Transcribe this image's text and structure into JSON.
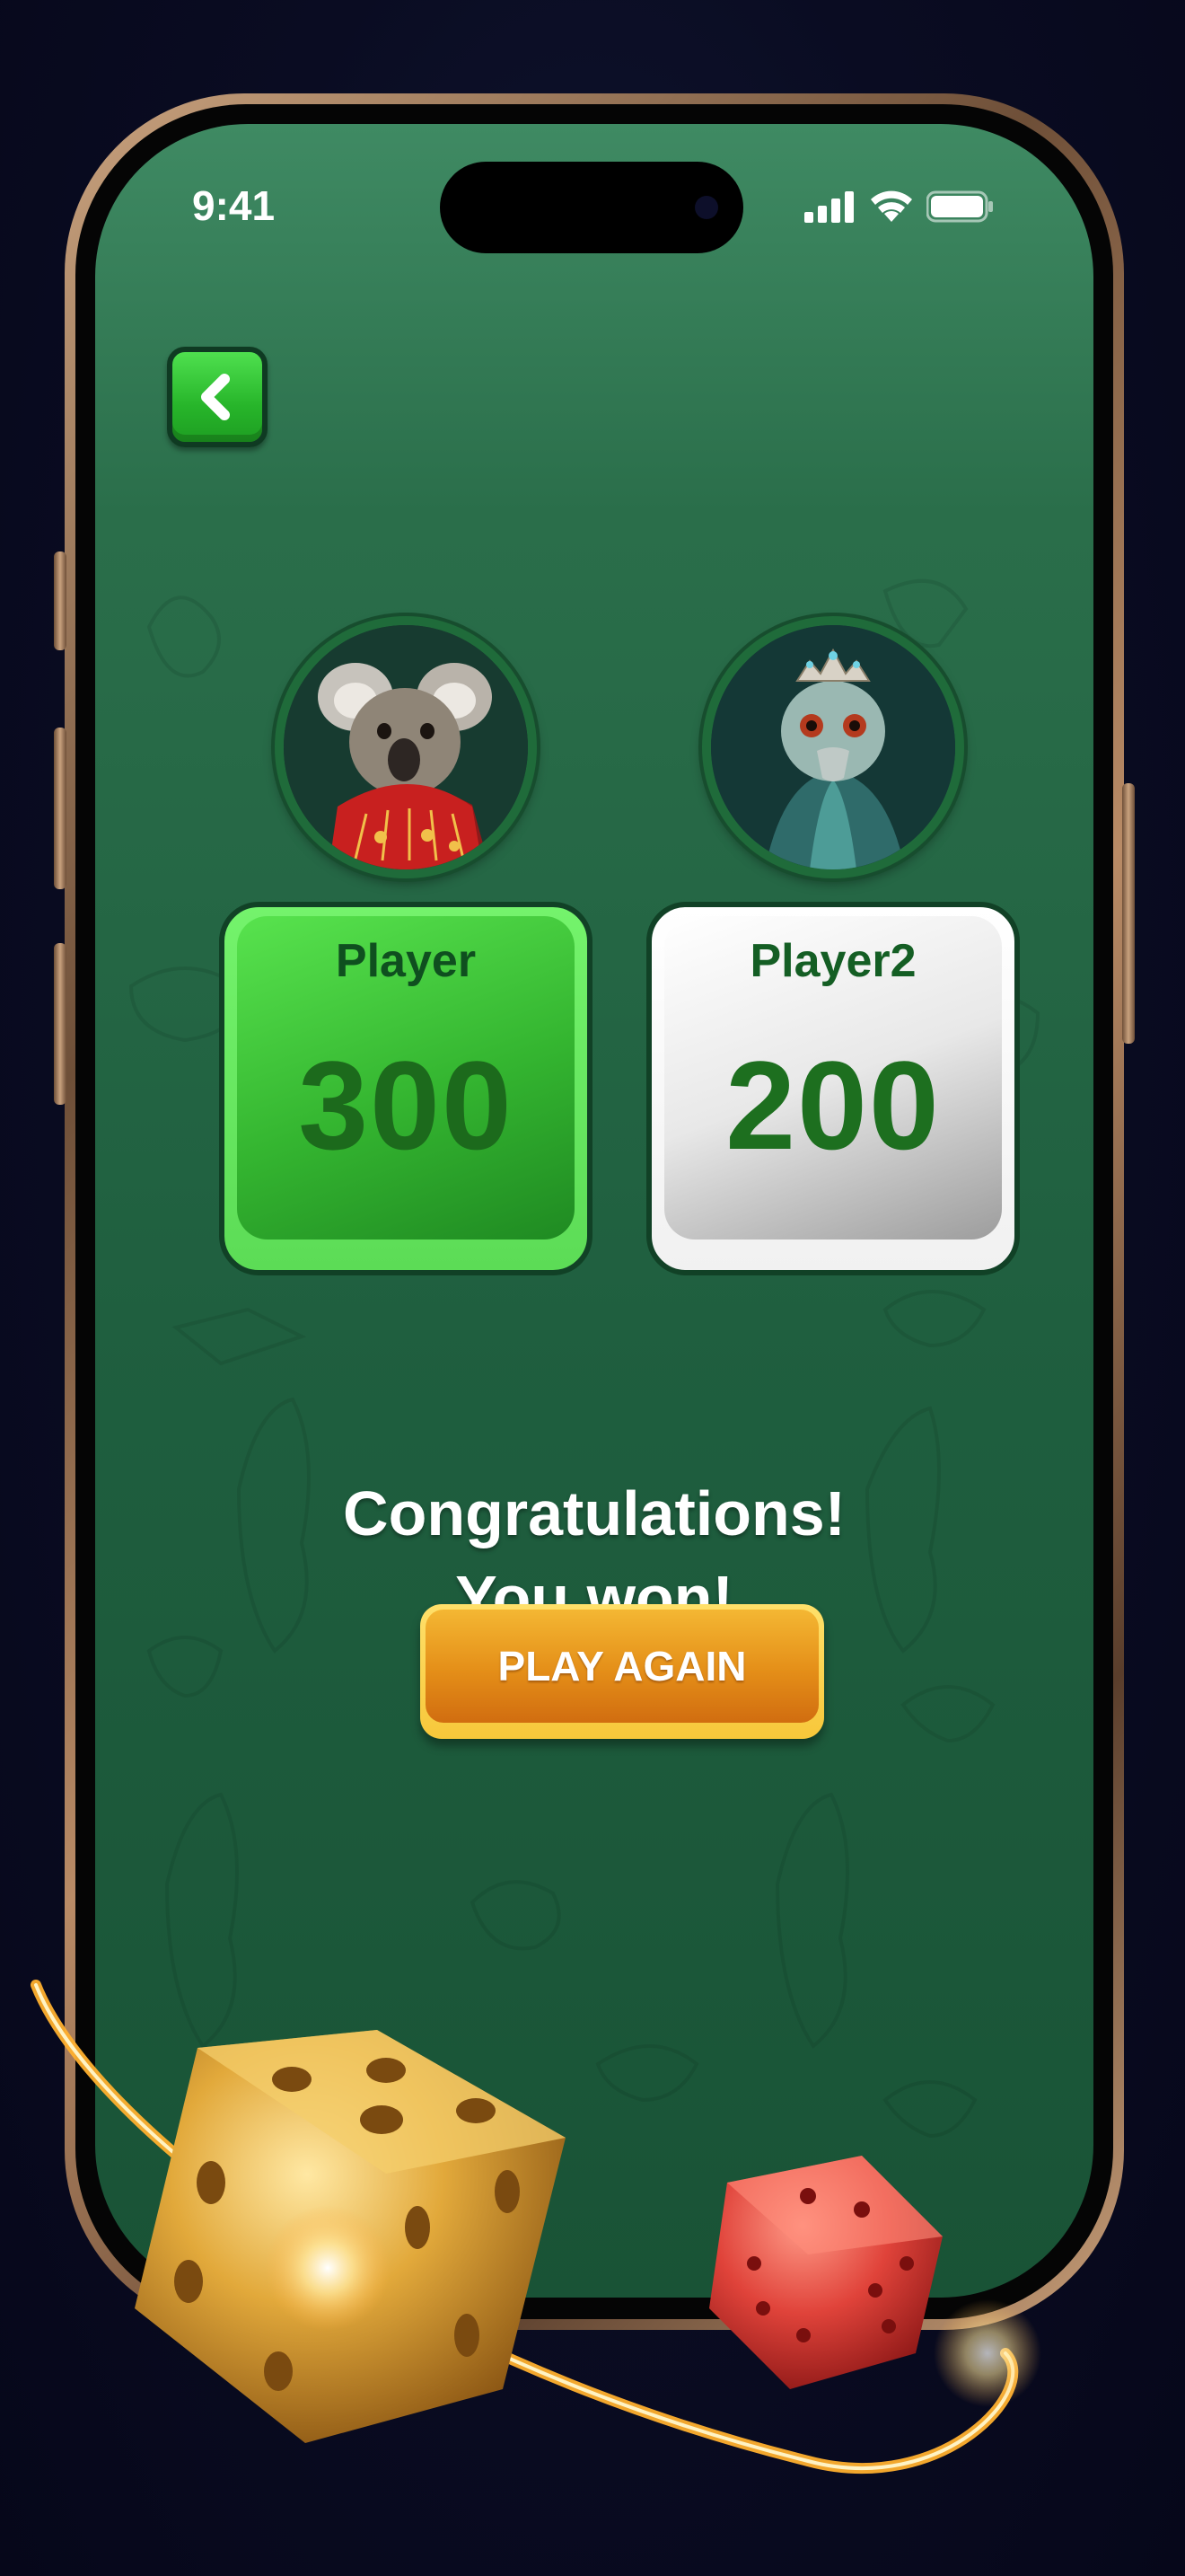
{
  "status_bar": {
    "time": "9:41"
  },
  "players": [
    {
      "name": "Player",
      "score": "300",
      "avatar": "koala-avatar",
      "card_color": "#3ccf3a"
    },
    {
      "name": "Player2",
      "score": "200",
      "avatar": "emu-avatar",
      "card_color": "#f2f2f2"
    }
  ],
  "result": {
    "line1": "Congratulations!",
    "line2": "You won!"
  },
  "play_again": {
    "label": "PLAY AGAIN"
  },
  "icons": {
    "back": "chevron-left-icon",
    "signal": "signal-icon",
    "wifi": "wifi-icon",
    "battery": "battery-icon"
  },
  "colors": {
    "accent_green": "#2fb52f",
    "board_green": "#1f5f3f",
    "gold_button": "#e69119"
  }
}
